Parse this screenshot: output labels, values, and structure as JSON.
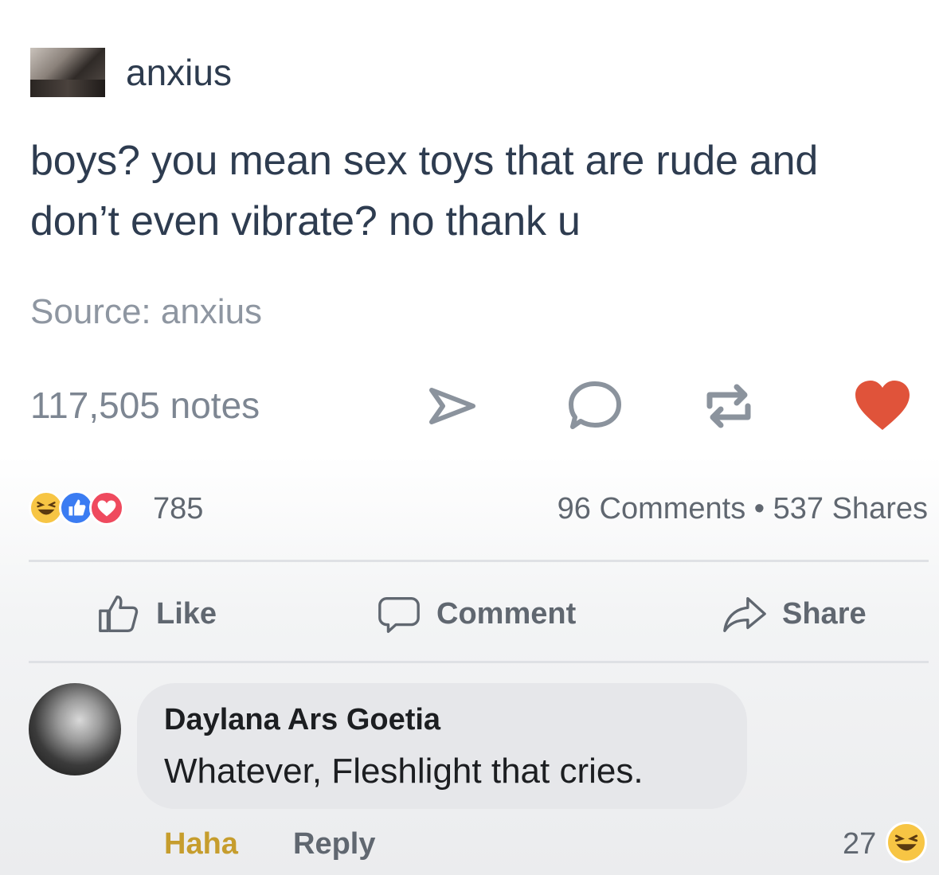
{
  "tumblr": {
    "username": "anxius",
    "post_text": "boys? you mean sex toys that are rude and don’t even vibrate? no thank u",
    "source": "Source: anxius",
    "notes": "117,505 notes",
    "icons": [
      "send-icon",
      "comment-icon",
      "reblog-icon",
      "heart-icon"
    ],
    "heart_color": "#e0533a"
  },
  "facebook": {
    "reactions": [
      "haha-reaction-icon",
      "like-reaction-icon",
      "love-reaction-icon"
    ],
    "reaction_count": "785",
    "stats": "96 Comments • 537 Shares",
    "actions": {
      "like": "Like",
      "comment": "Comment",
      "share": "Share"
    },
    "comment": {
      "author": "Daylana Ars Goetia",
      "text": "Whatever, Fleshlight that cries.",
      "haha_label": "Haha",
      "reply_label": "Reply",
      "reaction_count": "27",
      "haha_color": "#c69d2d"
    }
  }
}
